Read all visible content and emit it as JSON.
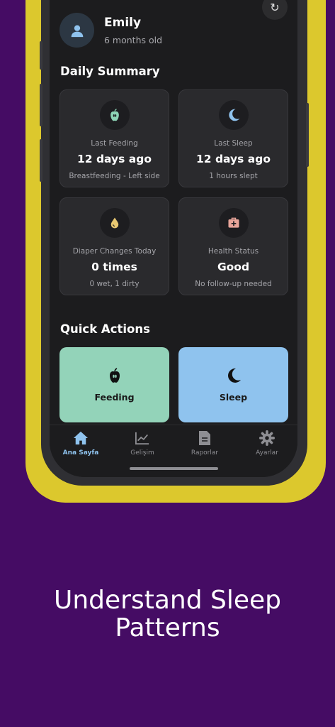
{
  "profile": {
    "name": "Emily",
    "age": "6 months old"
  },
  "daily_summary": {
    "title": "Daily Summary",
    "cards": [
      {
        "icon": "apple-icon",
        "label": "Last Feeding",
        "value": "12 days ago",
        "sub": "Breastfeeding - Left side",
        "icon_color": "#8dd3b5"
      },
      {
        "icon": "moon-icon",
        "label": "Last Sleep",
        "value": "12 days ago",
        "sub": "1 hours slept",
        "icon_color": "#8fc3ee"
      },
      {
        "icon": "drop-icon",
        "label": "Diaper Changes Today",
        "value": "0 times",
        "sub": "0 wet, 1 dirty",
        "icon_color": "#e8c872"
      },
      {
        "icon": "medical-kit-icon",
        "label": "Health Status",
        "value": "Good",
        "sub": "No follow-up needed",
        "icon_color": "#e8a59a"
      }
    ]
  },
  "quick_actions": {
    "title": "Quick Actions",
    "items": [
      {
        "label": "Feeding",
        "icon": "apple-icon",
        "color": "#93d3b9"
      },
      {
        "label": "Sleep",
        "icon": "moon-icon",
        "color": "#8fc3ee"
      }
    ]
  },
  "tabs": [
    {
      "label": "Ana Sayfa",
      "icon": "home-icon",
      "active": true
    },
    {
      "label": "Gelişim",
      "icon": "chart-icon",
      "active": false
    },
    {
      "label": "Raporlar",
      "icon": "document-icon",
      "active": false
    },
    {
      "label": "Ayarlar",
      "icon": "gear-icon",
      "active": false
    }
  ],
  "tagline": {
    "line1": "Understand Sleep",
    "line2": "Patterns"
  },
  "colors": {
    "background": "#450c64",
    "frame": "#dcc82d",
    "accent": "#8fc3ee"
  }
}
